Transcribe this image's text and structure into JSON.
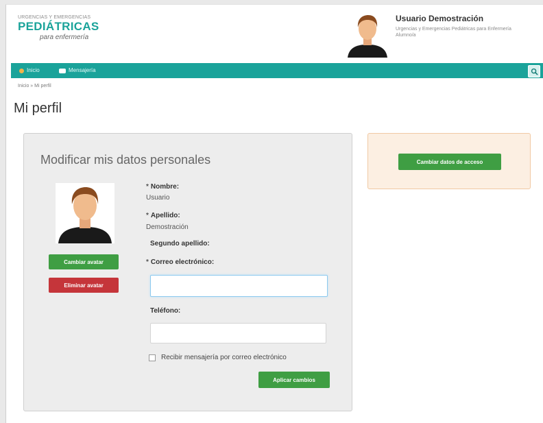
{
  "header": {
    "logo_top": "URGENCIAS Y EMERGENCIAS",
    "logo_main": "PEDIÁTRICAS",
    "logo_sub": "para enfermería",
    "user_name": "Usuario Demostración",
    "user_course": "Urgencias y Emergencias Pediátricas para Enfermería",
    "user_role": "Alumno/a"
  },
  "nav": {
    "home_label": "Inicio",
    "messaging_label": "Mensajería"
  },
  "breadcrumb": "Inicio » Mi perfil",
  "page_title": "Mi perfil",
  "profile_form": {
    "title": "Modificar mis datos personales",
    "change_avatar_label": "Cambiar avatar",
    "delete_avatar_label": "Eliminar avatar",
    "first_name_label": "Nombre:",
    "first_name_value": "Usuario",
    "last_name_label": "Apellido:",
    "last_name_value": "Demostración",
    "second_last_name_label": "Segundo apellido:",
    "email_label": "Correo electrónico:",
    "email_value": "",
    "phone_label": "Teléfono:",
    "phone_value": "",
    "email_messaging_checkbox_label": "Recibir mensajería por correo electrónico",
    "email_messaging_checked": false,
    "apply_label": "Aplicar cambios"
  },
  "access_panel": {
    "change_access_label": "Cambiar datos de acceso"
  },
  "colors": {
    "primary_teal": "#1aa39a",
    "button_green": "#3f9e43",
    "button_red": "#c5353a",
    "side_panel_bg": "#fcefe2"
  },
  "icons": {
    "home": "home-icon",
    "messaging": "message-icon",
    "search": "search-icon",
    "avatar": "user-avatar-icon"
  }
}
